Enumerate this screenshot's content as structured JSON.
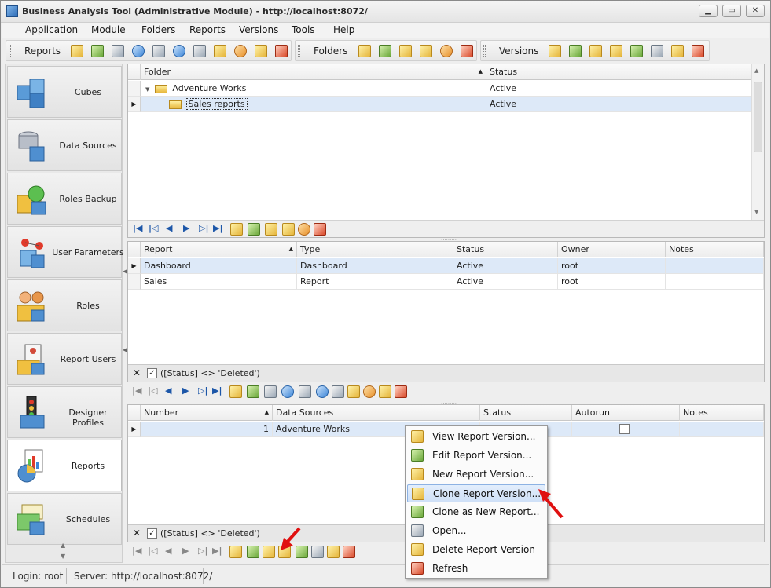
{
  "window": {
    "title": "Business Analysis Tool (Administrative Module) - http://localhost:8072/"
  },
  "menu": [
    "Application",
    "Module",
    "Folders",
    "Reports",
    "Versions",
    "Tools",
    "Help"
  ],
  "toolbars": {
    "reports_label": "Reports",
    "folders_label": "Folders",
    "versions_label": "Versions"
  },
  "sidebar": {
    "items": [
      {
        "label": "Cubes"
      },
      {
        "label": "Data Sources"
      },
      {
        "label": "Roles Backup"
      },
      {
        "label": "User Parameters"
      },
      {
        "label": "Roles"
      },
      {
        "label": "Report Users"
      },
      {
        "label": "Designer Profiles"
      },
      {
        "label": "Reports",
        "selected": true
      },
      {
        "label": "Schedules"
      }
    ]
  },
  "folders_grid": {
    "headers": [
      "Folder",
      "Status"
    ],
    "rows": [
      {
        "folder": "Adventure Works",
        "status": "Active"
      },
      {
        "folder": "Sales reports",
        "status": "Active"
      }
    ]
  },
  "reports_grid": {
    "headers": [
      "Report",
      "Type",
      "Status",
      "Owner",
      "Notes"
    ],
    "rows": [
      {
        "report": "Dashboard",
        "type": "Dashboard",
        "status": "Active",
        "owner": "root",
        "notes": ""
      },
      {
        "report": "Sales",
        "type": "Report",
        "status": "Active",
        "owner": "root",
        "notes": ""
      }
    ],
    "filter": "([Status] <> 'Deleted')"
  },
  "versions_grid": {
    "headers": [
      "Number",
      "Data Sources",
      "Status",
      "Autorun",
      "Notes"
    ],
    "rows": [
      {
        "number": "1",
        "data_sources": "Adventure Works",
        "status": "",
        "autorun": false,
        "notes": ""
      }
    ],
    "filter": "([Status] <> 'Deleted')"
  },
  "context_menu": {
    "items": [
      {
        "label": "View Report Version...",
        "icon": "view-icon"
      },
      {
        "label": "Edit Report Version...",
        "icon": "edit-icon"
      },
      {
        "label": "New Report Version...",
        "icon": "new-icon"
      },
      {
        "label": "Clone Report Version...",
        "icon": "clone-icon",
        "highlighted": true
      },
      {
        "label": "Clone as New Report...",
        "icon": "clone-new-icon"
      },
      {
        "label": "Open...",
        "icon": "open-icon"
      },
      {
        "label": "Delete Report Version",
        "icon": "delete-icon"
      },
      {
        "label": "Refresh",
        "icon": "refresh-icon"
      }
    ]
  },
  "status": {
    "login": "Login: root",
    "server": "Server: http://localhost:8072/"
  },
  "colors": {
    "accent": "#3d86d8",
    "selection": "#dde9f8",
    "arrow": "#e01010"
  }
}
